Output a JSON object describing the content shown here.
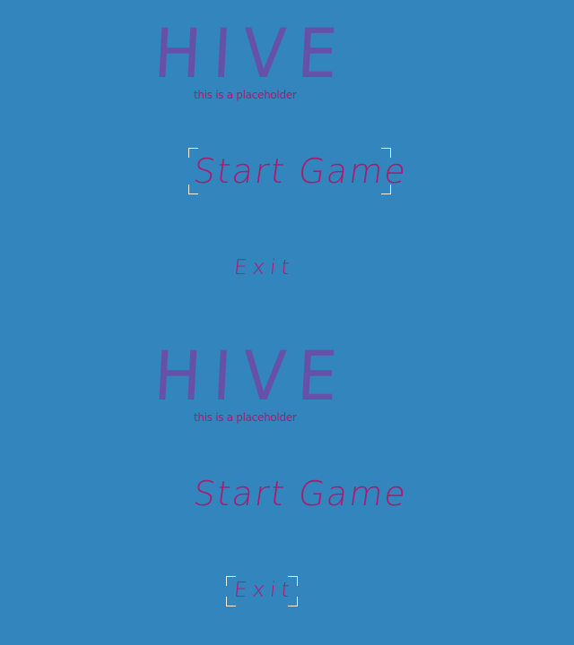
{
  "screens": [
    {
      "title": "HIVE",
      "subtitle": "this is a placeholder",
      "menu": {
        "start_label": "Start Game",
        "exit_label": "Exit",
        "selected": "start"
      }
    },
    {
      "title": "HIVE",
      "subtitle": "this is a placeholder",
      "menu": {
        "start_label": "Start Game",
        "exit_label": "Exit",
        "selected": "exit"
      }
    }
  ],
  "colors": {
    "background": "#3285bd",
    "title": "#6650a8",
    "text": "#b0176e",
    "selection": "#f1efe1"
  }
}
